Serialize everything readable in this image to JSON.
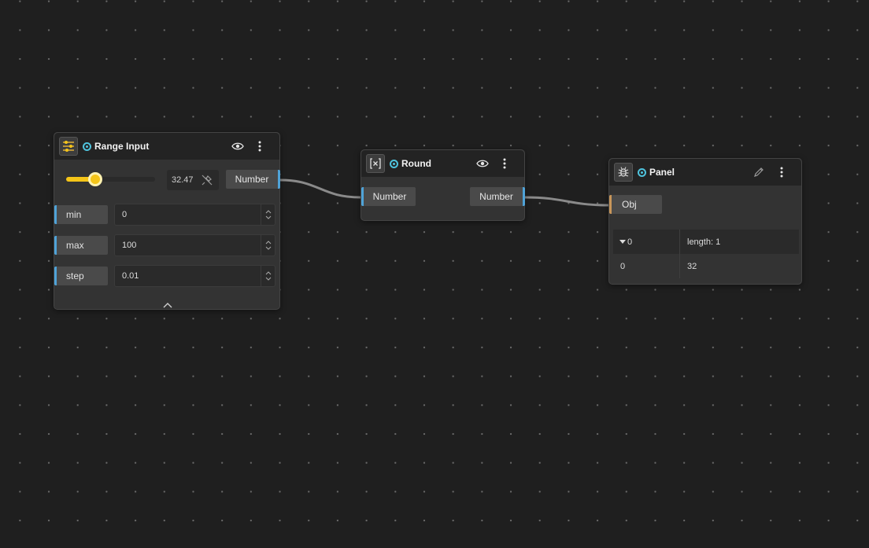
{
  "colors": {
    "canvas": "#1f1f1f",
    "node": "#333333",
    "header": "#232323",
    "port_accent": "#4fa3d8",
    "obj_port_accent": "#c8965a",
    "status_dot": "#4fc3dd",
    "slider_accent": "#f5c518",
    "wire": "#8a8a8a"
  },
  "range_node": {
    "icon": "sliders-icon",
    "title": "Range Input",
    "slider_value": "32.47",
    "slider_fraction": 0.3247,
    "output_label": "Number",
    "params": [
      {
        "label": "min",
        "value": "0"
      },
      {
        "label": "max",
        "value": "100"
      },
      {
        "label": "step",
        "value": "0.01"
      }
    ]
  },
  "round_node": {
    "icon": "variable-brackets-icon",
    "title": "Round",
    "input_label": "Number",
    "output_label": "Number"
  },
  "panel_node": {
    "icon": "bug-icon",
    "title": "Panel",
    "input_label": "Obj",
    "table": {
      "header_key": "0",
      "header_value": "length: 1",
      "row_key": "0",
      "row_value": "32"
    }
  }
}
